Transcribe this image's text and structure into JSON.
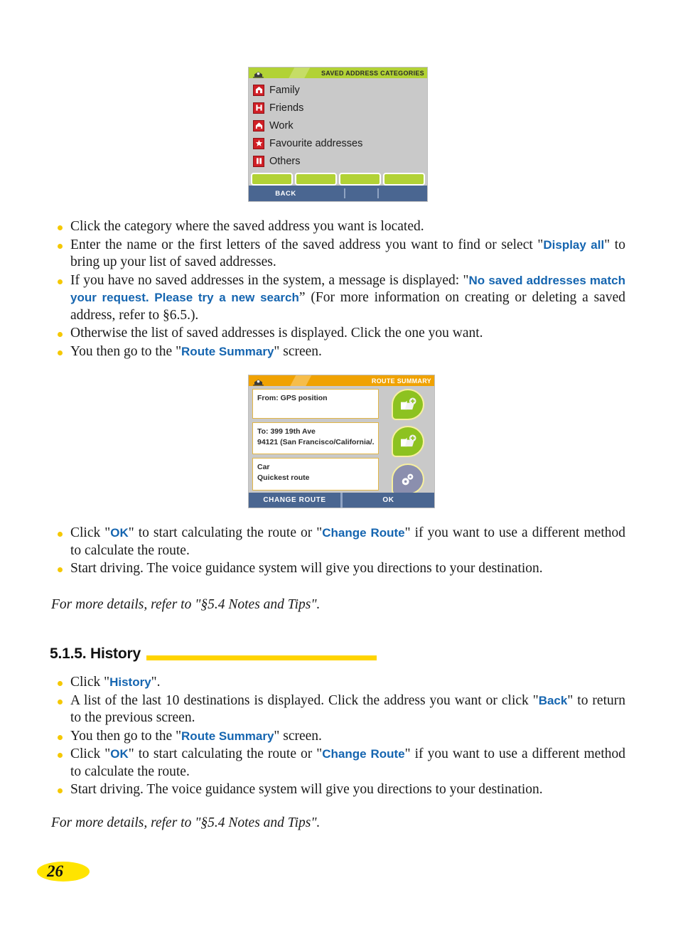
{
  "page": {
    "number": "26"
  },
  "screens": {
    "saved_address_categories": {
      "title": "SAVED ADDRESS CATEGORIES",
      "home_icon": "home-icon",
      "items": [
        {
          "label": "Family",
          "icon": "family-house-icon"
        },
        {
          "label": "Friends",
          "icon": "friends-house-icon"
        },
        {
          "label": "Work",
          "icon": "work-building-icon"
        },
        {
          "label": "Favourite addresses",
          "icon": "star-icon"
        },
        {
          "label": "Others",
          "icon": "others-icon"
        }
      ],
      "quick_buttons": [
        "",
        "",
        "",
        ""
      ],
      "back_label": "BACK",
      "colors": {
        "title_bar": "#b2d235",
        "body": "#c9c9c9",
        "bottom_bar": "#4a6691",
        "icon": "#d01f26"
      }
    },
    "route_summary": {
      "title": "ROUTE SUMMARY",
      "home_icon": "home-icon",
      "fields": [
        {
          "name": "from-field",
          "lines": [
            "From: GPS position"
          ]
        },
        {
          "name": "to-field",
          "lines": [
            "To: 399 19th Ave",
            "94121 (San Francisco/California/..."
          ]
        },
        {
          "name": "route-method-field",
          "lines": [
            "Car",
            "Quickest route"
          ]
        }
      ],
      "side_icons": [
        {
          "name": "save-from-icon",
          "glyph": "folder-plus-icon",
          "style": "green"
        },
        {
          "name": "save-to-icon",
          "glyph": "folder-plus-icon",
          "style": "green"
        },
        {
          "name": "route-settings-icon",
          "glyph": "gears-icon",
          "style": "gray"
        }
      ],
      "buttons": [
        {
          "name": "change-route-button",
          "label": "CHANGE ROUTE"
        },
        {
          "name": "ok-button",
          "label": "OK"
        }
      ],
      "colors": {
        "title_bar": "#f0a202",
        "body": "#c9c9c9",
        "bottom_bar": "#4a6691",
        "field_border": "#e2b646"
      }
    }
  },
  "body": {
    "list_one": {
      "b1": {
        "t1": "Click the category where the saved address you want is located."
      },
      "b2": {
        "t1": "Enter the name or the first letters of the saved address you want to find or select \"",
        "link": "Display all",
        "t2": "\" to bring up your list of saved addresses."
      },
      "b3": {
        "t1": "If you have no saved addresses in the system, a message is displayed: \"",
        "link": "No saved addresses match your request. Please try a new search",
        "t2": "” (For more information on creating or deleting a saved address, refer to §6.5.)."
      },
      "b4": {
        "t1": "Otherwise the list of saved addresses is displayed. Click the one you want."
      },
      "b5": {
        "t1": "You then go to the \"",
        "link": "Route Summary",
        "t2": "\" screen."
      }
    },
    "list_two": {
      "b1": {
        "t1": "Click \"",
        "link1": "OK",
        "t2": "\" to start calculating the route or \"",
        "link2": "Change Route",
        "t3": "\" if you want to use a different method to calculate the route."
      },
      "b2": {
        "t1": "Start driving. The voice guidance system will give you directions to your destination."
      }
    },
    "note_one": "For more details, refer to \"§5.4 Notes and Tips\".",
    "heading": "5.1.5. History",
    "list_three": {
      "b1": {
        "t1": "Click \"",
        "link": "History",
        "t2": "\"."
      },
      "b2": {
        "t1": "A list of the last 10 destinations is displayed. Click the address you want or click \"",
        "link": "Back",
        "t2": "\" to return to the previous screen."
      },
      "b3": {
        "t1": "You then go to the \"",
        "link": "Route Summary",
        "t2": "\" screen."
      },
      "b4": {
        "t1": "Click \"",
        "link1": "OK",
        "t2": "\" to start calculating the route or \"",
        "link2": "Change Route",
        "t3": "\" if you want to use a different method to calculate the route."
      },
      "b5": {
        "t1": "Start driving. The voice guidance system will give you directions to your destination."
      }
    },
    "note_two": "For more details, refer to \"§5.4 Notes and Tips\"."
  }
}
